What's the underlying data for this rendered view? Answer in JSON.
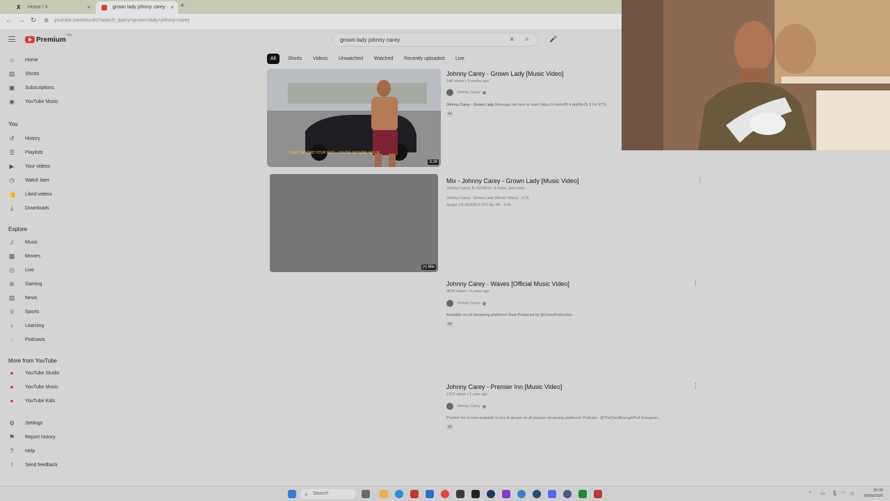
{
  "browser": {
    "tabs": [
      {
        "label": "Home / X",
        "active": false
      },
      {
        "label": "grown lady johnny carey - YouTube",
        "active": true
      }
    ],
    "url": "youtube.com/results?search_query=grown+lady+johnny+carey"
  },
  "logo": {
    "text": "Premium",
    "sup": "GB"
  },
  "search": {
    "value": "grown lady johnny carey"
  },
  "sidebar": {
    "main": [
      {
        "label": "Home",
        "icon": "home-icon",
        "glyph": "⌂"
      },
      {
        "label": "Shorts",
        "icon": "shorts-icon",
        "glyph": "▤"
      },
      {
        "label": "Subscriptions",
        "icon": "subscriptions-icon",
        "glyph": "▣"
      },
      {
        "label": "YouTube Music",
        "icon": "music-disc-icon",
        "glyph": "◉"
      }
    ],
    "you_heading": "You",
    "you": [
      {
        "label": "History",
        "icon": "history-icon",
        "glyph": "↺"
      },
      {
        "label": "Playlists",
        "icon": "playlists-icon",
        "glyph": "☰"
      },
      {
        "label": "Your videos",
        "icon": "your-videos-icon",
        "glyph": "▶"
      },
      {
        "label": "Watch later",
        "icon": "clock-icon",
        "glyph": "◷"
      },
      {
        "label": "Liked videos",
        "icon": "thumbs-up-icon",
        "glyph": "👍"
      },
      {
        "label": "Downloads",
        "icon": "download-icon",
        "glyph": "⤓"
      }
    ],
    "explore_heading": "Explore",
    "explore": [
      {
        "label": "Music",
        "icon": "music-note-icon",
        "glyph": "♫"
      },
      {
        "label": "Movies",
        "icon": "film-icon",
        "glyph": "▦"
      },
      {
        "label": "Live",
        "icon": "live-icon",
        "glyph": "◎"
      },
      {
        "label": "Gaming",
        "icon": "gamepad-icon",
        "glyph": "⊛"
      },
      {
        "label": "News",
        "icon": "news-icon",
        "glyph": "▤"
      },
      {
        "label": "Sports",
        "icon": "trophy-icon",
        "glyph": "♕"
      },
      {
        "label": "Learning",
        "icon": "bulb-icon",
        "glyph": "♁"
      },
      {
        "label": "Podcasts",
        "icon": "podcast-icon",
        "glyph": "◌"
      }
    ],
    "more_heading": "More from YouTube",
    "more": [
      {
        "label": "YouTube Studio",
        "icon": "youtube-studio-icon",
        "glyph": "●"
      },
      {
        "label": "YouTube Music",
        "icon": "youtube-music-icon",
        "glyph": "●"
      },
      {
        "label": "YouTube Kids",
        "icon": "youtube-kids-icon",
        "glyph": "●"
      }
    ],
    "footer": [
      {
        "label": "Settings",
        "icon": "gear-icon",
        "glyph": "⚙"
      },
      {
        "label": "Report history",
        "icon": "flag-icon",
        "glyph": "⚑"
      },
      {
        "label": "Help",
        "icon": "help-icon",
        "glyph": "?"
      },
      {
        "label": "Send feedback",
        "icon": "feedback-icon",
        "glyph": "!"
      }
    ]
  },
  "chips": [
    "All",
    "Shorts",
    "Videos",
    "Unwatched",
    "Watched",
    "Recently uploaded",
    "Live"
  ],
  "results": [
    {
      "title": "Johnny Carey - Grown Lady [Music Video]",
      "meta": "14K views • 3 weeks ago",
      "channel": "Johnny Carey",
      "desc_bold": "Johnny Carey - Grown Lady",
      "desc": "Message me here to start: https://t.me/m/f3 4 pbjMmZk 3 f 4 STYL",
      "tag": "4K",
      "duration": "3:16",
      "subtitle": "I CAN'T AFFORD YOUR GIFT... YOU'RE DETUINE SO LIE"
    },
    {
      "title": "Mix - Johnny Carey - Grown Lady [Music Video]",
      "meta": "Johnny Carey, B.JICKBOX, K Koke, and more",
      "line1": "Johnny Carey - Grown Lady [Music Video] · 3:16",
      "line2": "Singer | B.JICKBOX 071 Ep. 94 · 3:44",
      "duration": "(•) Mix"
    },
    {
      "title": "Johnny Carey - Waves [Official Music Video]",
      "meta": "987K views • 4 years ago",
      "channel": "Johnny Carey",
      "desc": "Available on all streaming platforms! Beat Produced by @ChizoProduction.",
      "tag": "4K"
    },
    {
      "title": "Johnny Carey - Premier Inn [Music Video]",
      "meta": "121K views • 1 year ago",
      "channel": "Johnny Carey",
      "desc": "Premier Inn is now available to buy & stream on all popular streaming platforms! Podcast - @TheGoodEnoughPod Instagram...",
      "tag": "4K"
    }
  ],
  "taskbar": {
    "search": "Search",
    "time": "20:39",
    "date": "06/09/2025"
  }
}
